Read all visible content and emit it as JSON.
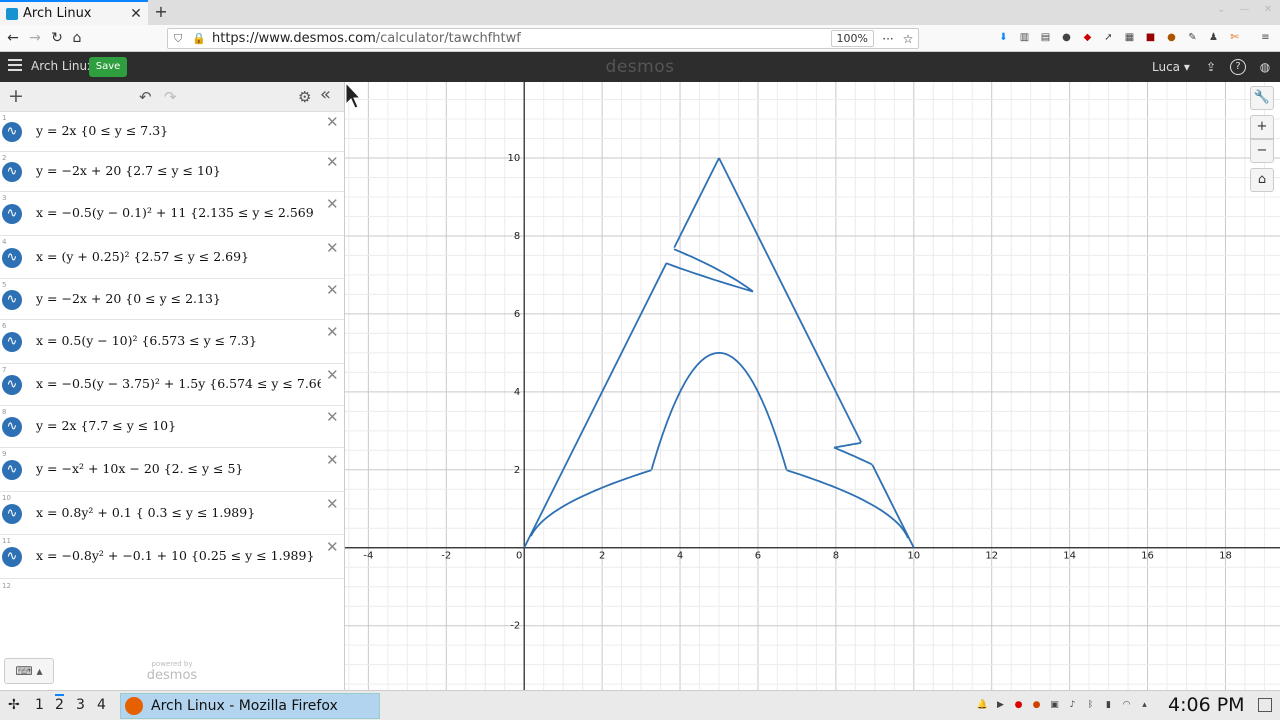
{
  "browser": {
    "tab_title": "Arch Linux",
    "tab_close": "✕",
    "new_tab": "+",
    "url_host": "https://www.desmos.com",
    "url_path": "/calculator/tawchfhtwf",
    "zoom": "100%",
    "more": "···",
    "star": "☆",
    "back": "←",
    "forward": "→",
    "reload": "↻",
    "home": "⌂",
    "lock": "🔒",
    "shield": "⛉",
    "win_controls": [
      "⌄",
      "—",
      "✕"
    ]
  },
  "header": {
    "graph_title": "Arch Linux",
    "save_label": "Save",
    "logo": "desmos",
    "user": "Luca ▾",
    "share": "⇪",
    "help": "?",
    "lang": "◍"
  },
  "toolbar": {
    "add": "+",
    "undo": "↶",
    "redo": "↷",
    "settings": "⚙",
    "collapse": "«"
  },
  "expressions": [
    {
      "index": "1",
      "latex": "y = 2x {0 ≤ y ≤ 7.3}"
    },
    {
      "index": "2",
      "latex": "y = −2x + 20 {2.7 ≤ y ≤ 10}"
    },
    {
      "index": "3",
      "latex": "x = −0.5(y − 0.1)² + 11 {2.135 ≤ y ≤ 2.569"
    },
    {
      "index": "4",
      "latex": "x = (y + 0.25)² {2.57 ≤ y ≤ 2.69}"
    },
    {
      "index": "5",
      "latex": "y = −2x + 20 {0 ≤ y ≤ 2.13}"
    },
    {
      "index": "6",
      "latex": "x = 0.5(y − 10)² {6.573 ≤ y ≤ 7.3}"
    },
    {
      "index": "7",
      "latex": "x = −0.5(y − 3.75)² + 1.5y {6.574 ≤ y ≤ 7.66"
    },
    {
      "index": "8",
      "latex": "y = 2x {7.7 ≤ y ≤ 10}"
    },
    {
      "index": "9",
      "latex": "y = −x² + 10x − 20 {2. ≤ y ≤ 5}"
    },
    {
      "index": "10",
      "latex": "x = 0.8y² + 0.1 { 0.3 ≤ y ≤ 1.989}"
    },
    {
      "index": "11",
      "latex": "x = −0.8y² + −0.1 + 10 {0.25 ≤ y ≤ 1.989}"
    }
  ],
  "empty_index": "12",
  "delete_symbol": "✕",
  "keyboard_label": "⌨ ▴",
  "powered": {
    "small": "powered by",
    "big": "desmos"
  },
  "graph": {
    "xmin": -4.6,
    "xmax": 19.4,
    "ymin": -3.65,
    "ymax": 11.95,
    "x_ticks": [
      "-4",
      "-2",
      "0",
      "2",
      "4",
      "6",
      "8",
      "10",
      "12",
      "14",
      "16",
      "18"
    ],
    "y_ticks": [
      "10",
      "8",
      "6",
      "4",
      "2",
      "-2"
    ],
    "curve_color": "#2d70b3",
    "controls": {
      "wrench": "🔧",
      "zoom_in": "+",
      "zoom_out": "−",
      "home": "⌂"
    }
  },
  "taskbar": {
    "launcher": "✢",
    "workspaces": [
      "1",
      "2",
      "3",
      "4"
    ],
    "app_label": "Arch Linux - Mozilla Firefox",
    "clock": "4:06 PM"
  }
}
